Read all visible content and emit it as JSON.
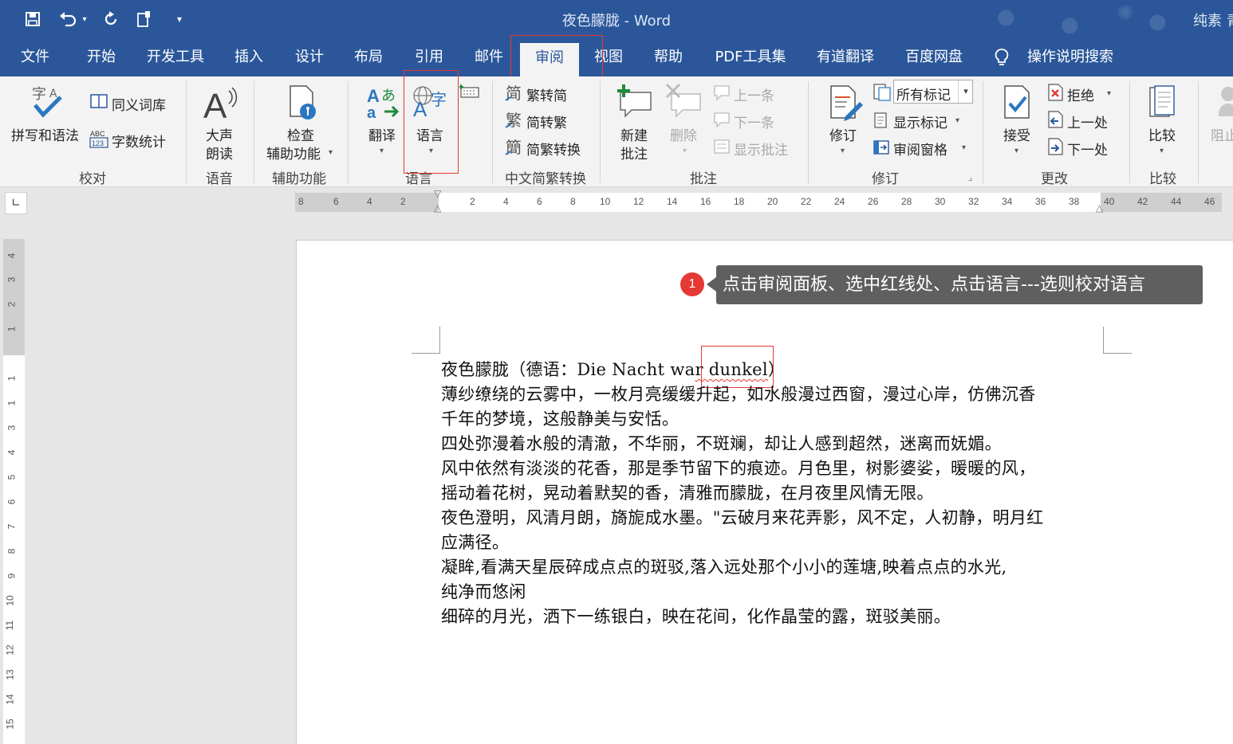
{
  "app": {
    "title": "夜色朦胧 - Word",
    "user": "纯素 青"
  },
  "quick_access": {
    "save_icon": "save-icon",
    "undo_icon": "undo-icon",
    "redo_icon": "redo-icon",
    "touch_icon": "touch-mode-icon",
    "customize_icon": "customize-icon"
  },
  "tabs": [
    {
      "label": "文件"
    },
    {
      "label": "开始"
    },
    {
      "label": "开发工具"
    },
    {
      "label": "插入"
    },
    {
      "label": "设计"
    },
    {
      "label": "布局"
    },
    {
      "label": "引用"
    },
    {
      "label": "邮件"
    },
    {
      "label": "审阅",
      "active": true
    },
    {
      "label": "视图"
    },
    {
      "label": "帮助"
    },
    {
      "label": "PDF工具集"
    },
    {
      "label": "有道翻译"
    },
    {
      "label": "百度网盘"
    },
    {
      "label": "操作说明搜索"
    }
  ],
  "ribbon": {
    "proofing": {
      "spelling": "拼写和语法",
      "thesaurus": "同义词库",
      "word_count": "字数统计",
      "group": "校对"
    },
    "speech": {
      "read_aloud_1": "大声",
      "read_aloud_2": "朗读",
      "group": "语音"
    },
    "accessibility": {
      "check_1": "检查",
      "check_2": "辅助功能",
      "group": "辅助功能"
    },
    "language": {
      "translate": "翻译",
      "language": "语言",
      "group": "语言"
    },
    "chinese_conversion": {
      "to_simplified": "繁转简",
      "to_traditional": "简转繁",
      "conversion": "简繁转换",
      "group": "中文简繁转换"
    },
    "comments": {
      "new_1": "新建",
      "new_2": "批注",
      "delete": "删除",
      "previous": "上一条",
      "next": "下一条",
      "show": "显示批注",
      "group": "批注"
    },
    "tracking": {
      "track": "修订",
      "markup_select": "所有标记",
      "show_markup": "显示标记",
      "pane": "审阅窗格",
      "group": "修订"
    },
    "changes": {
      "accept": "接受",
      "reject": "拒绝",
      "previous": "上一处",
      "next": "下一处",
      "group": "更改"
    },
    "compare": {
      "compare": "比较",
      "group": "比较"
    },
    "protect": {
      "block": "阻止"
    }
  },
  "ruler": {
    "left_ticks": [
      "8",
      "6",
      "4",
      "2"
    ],
    "right_ticks": [
      "2",
      "4",
      "6",
      "8",
      "10",
      "12",
      "14",
      "16",
      "18",
      "20",
      "22",
      "24",
      "26",
      "28",
      "30",
      "32",
      "34",
      "36",
      "38",
      "40",
      "42",
      "44",
      "46"
    ],
    "vertical_top": [
      "4",
      "3",
      "2",
      "1"
    ],
    "vertical_bottom": [
      "1",
      "1",
      "2",
      "3",
      "4",
      "5",
      "6",
      "7",
      "8",
      "9",
      "10",
      "11",
      "12",
      "13",
      "14",
      "15"
    ]
  },
  "callout": {
    "number": "1",
    "text": "点击审阅面板、选中红线处、点击语言---选则校对语言"
  },
  "document": {
    "title_prefix": "夜色朦胧（德语：Die Nacht wa",
    "title_word": "r dunkel",
    "title_suffix": "）",
    "lines": [
      "薄纱缭绕的云雾中，一枚月亮缓缓升起，如水般漫过西窗，漫过心岸，仿佛沉香",
      "千年的梦境，这般静美与安恬。",
      "四处弥漫着水般的清澈，不华丽，不斑斓，却让人感到超然，迷离而妩媚。",
      "风中依然有淡淡的花香，那是季节留下的痕迹。月色里，树影婆娑，暖暖的风，",
      "摇动着花树，晃动着默契的香，清雅而朦胧，在月夜里风情无限。",
      "夜色澄明，风清月朗，旖旎成水墨。\"云破月来花弄影，风不定，人初静，明月红",
      "应满径。",
      "凝眸,看满天星辰碎成点点的斑驳,落入远处那个小小的莲塘,映着点点的水光,",
      "纯净而悠闲",
      "细碎的月光，洒下一练银白，映在花间，化作晶莹的露，斑驳美丽。"
    ]
  }
}
